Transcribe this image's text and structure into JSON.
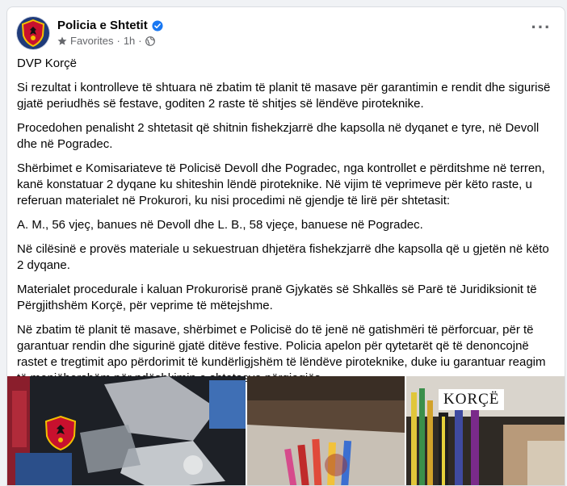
{
  "post": {
    "page_name": "Policia e Shtetit",
    "audience": "Favorites",
    "time": "1h",
    "paragraphs": [
      "DVP Korçë",
      "Si rezultat i kontrolleve të shtuara në zbatim të planit të masave për garantimin e rendit dhe sigurisë gjatë periudhës së festave, goditen 2 raste të shitjes së lëndëve piroteknike.",
      "Procedohen penalisht 2 shtetasit që shitnin fishekzjarrë dhe kapsolla në dyqanet e tyre, në Devoll dhe në Pogradec.",
      "Shërbimet e Komisariateve të Policisë Devoll dhe Pogradec, nga kontrollet e përditshme në terren, kanë konstatuar 2 dyqane ku shiteshin lëndë piroteknike. Në vijim të veprimeve për këto raste, u referuan materialet në Prokurori, ku nisi procedimi në gjendje të lirë për shtetasit:",
      "A. M., 56 vjeç, banues në Devoll dhe L. B., 58 vjeçe, banuese në Pogradec.",
      "Në cilësinë e provës materiale u sekuestruan dhjetëra fishekzjarrë dhe kapsolla që u gjetën në këto 2 dyqane.",
      "Materialet procedurale i kaluan Prokurorisë pranë Gjykatës së Shkallës së Parë të Juridiksionit të Përgjithshëm Korçë, për veprime të mëtejshme.",
      "Në zbatim të planit të masave, shërbimet e Policisë do të jenë në gatishmëri të përforcuar, për të garantuar rendin dhe sigurinë gjatë ditëve festive. Policia apelon për qytetarët që të denoncojnë rastet e tregtimit apo përdorimit të kundërligjshëm të lëndëve piroteknike, duke iu garantuar reagim të menjëhershëm për ndëshkimin e shtetasve përgjegjës."
    ],
    "photo_caption": "KORÇË"
  },
  "colors": {
    "verified": "#1877f2",
    "muted": "#65676b",
    "emblem_red": "#c8102e"
  },
  "icons": [
    "verified-badge-icon",
    "star-icon",
    "globe-icon",
    "more-options-icon",
    "police-emblem-icon"
  ]
}
